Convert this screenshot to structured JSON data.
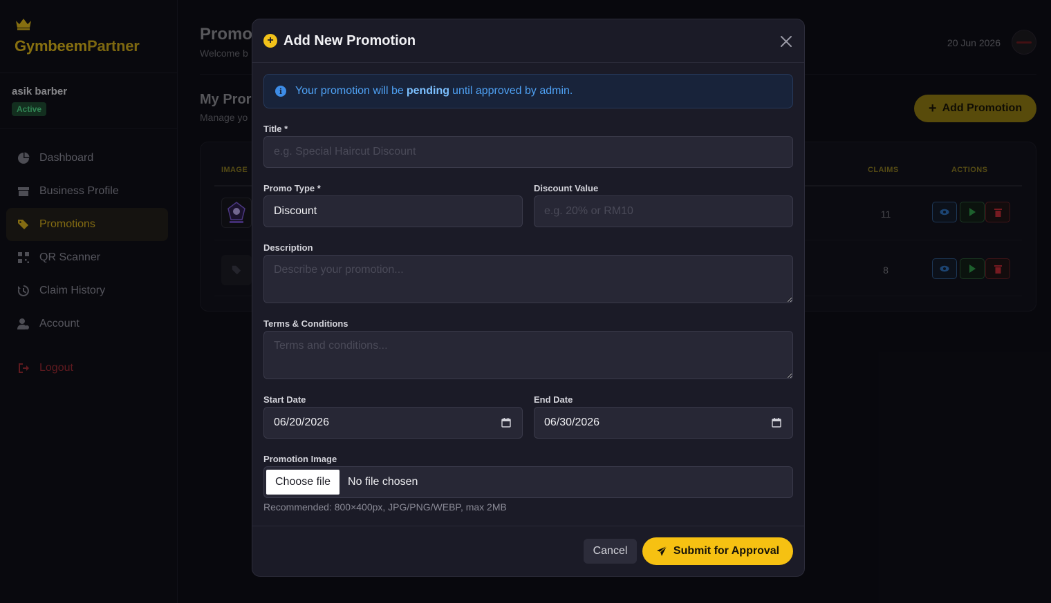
{
  "brand": {
    "part1": "Gymbeem",
    "part2": "Partner"
  },
  "user": {
    "name": "asik barber",
    "status": "Active"
  },
  "nav": [
    {
      "label": "Dashboard",
      "icon": "pie-chart-icon"
    },
    {
      "label": "Business Profile",
      "icon": "store-icon"
    },
    {
      "label": "Promotions",
      "icon": "tags-icon",
      "active": true
    },
    {
      "label": "QR Scanner",
      "icon": "qr-icon"
    },
    {
      "label": "Claim History",
      "icon": "history-icon"
    },
    {
      "label": "Account",
      "icon": "user-gear-icon"
    }
  ],
  "logout_label": "Logout",
  "header": {
    "title": "Promo",
    "subtitle": "Welcome b",
    "date": "20 Jun 2026"
  },
  "section": {
    "title": "My Pror",
    "subtitle": "Manage yo",
    "add_button": "Add Promotion"
  },
  "table": {
    "headers": {
      "image": "IMAGE",
      "claims": "CLAIMS",
      "actions": "ACTIONS"
    },
    "rows": [
      {
        "claims": "11"
      },
      {
        "claims": "8"
      }
    ]
  },
  "modal": {
    "title": "Add New Promotion",
    "notice": {
      "pre": "Your promotion will be",
      "bold": "pending",
      "post": "until approved by admin."
    },
    "fields": {
      "title_label": "Title *",
      "title_placeholder": "e.g. Special Haircut Discount",
      "promo_type_label": "Promo Type *",
      "promo_type_value": "Discount",
      "discount_label": "Discount Value",
      "discount_placeholder": "e.g. 20% or RM10",
      "description_label": "Description",
      "description_placeholder": "Describe your promotion...",
      "terms_label": "Terms & Conditions",
      "terms_placeholder": "Terms and conditions...",
      "start_label": "Start Date",
      "start_value": "06/20/2026",
      "end_label": "End Date",
      "end_value": "06/30/2026",
      "image_label": "Promotion Image",
      "choose_file": "Choose file",
      "no_file": "No file chosen",
      "image_hint": "Recommended: 800×400px, JPG/PNG/WEBP, max 2MB"
    },
    "cancel": "Cancel",
    "submit": "Submit for Approval"
  },
  "colors": {
    "accent": "#f6c112",
    "info": "#4ea0f2",
    "success": "#4ed587",
    "danger": "#9b2a33"
  }
}
